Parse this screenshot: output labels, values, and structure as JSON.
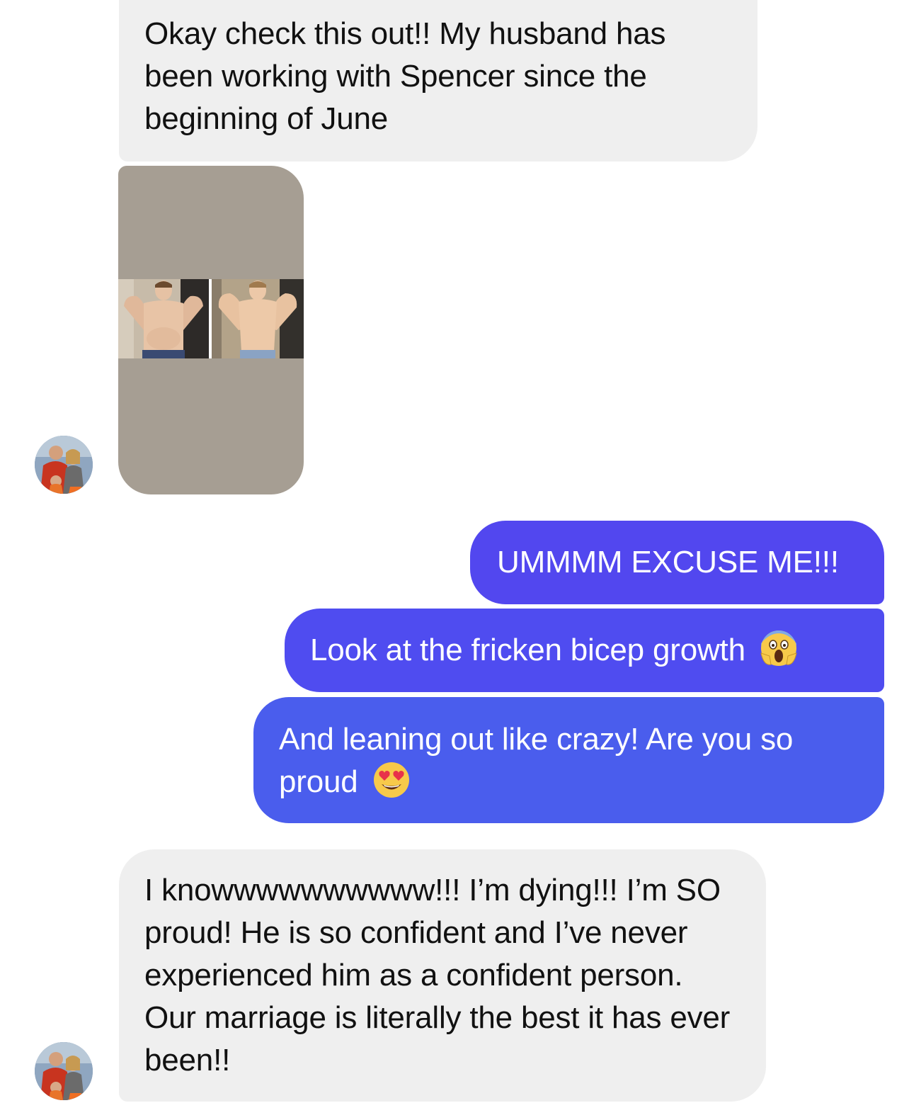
{
  "conversation": {
    "messages": [
      {
        "sender": "them",
        "text": "Okay check this out!! My husband has been working with Spencer since the beginning of June"
      },
      {
        "sender": "them",
        "type": "photo",
        "description": "before-after-photo"
      },
      {
        "sender": "me",
        "text": "UMMMM EXCUSE ME!!!"
      },
      {
        "sender": "me",
        "text": "Look at the fricken bicep growth",
        "emoji": "screaming-face-icon"
      },
      {
        "sender": "me",
        "text": "And leaning out like crazy! Are you so proud",
        "emoji": "heart-eyes-face-icon"
      },
      {
        "sender": "them",
        "text": "I knowwwwwwwwww!!! I’m dying!!! I’m SO proud! He is so confident and I’ve never experienced him as a confident person. Our marriage is literally the best it has ever been!!"
      }
    ]
  },
  "colors": {
    "incoming_bubble": "#efefef",
    "outgoing_top": "#5247ef",
    "outgoing_mid": "#4f4cf0",
    "outgoing_bottom": "#4a5ded",
    "photo_background": "#a69e93"
  }
}
